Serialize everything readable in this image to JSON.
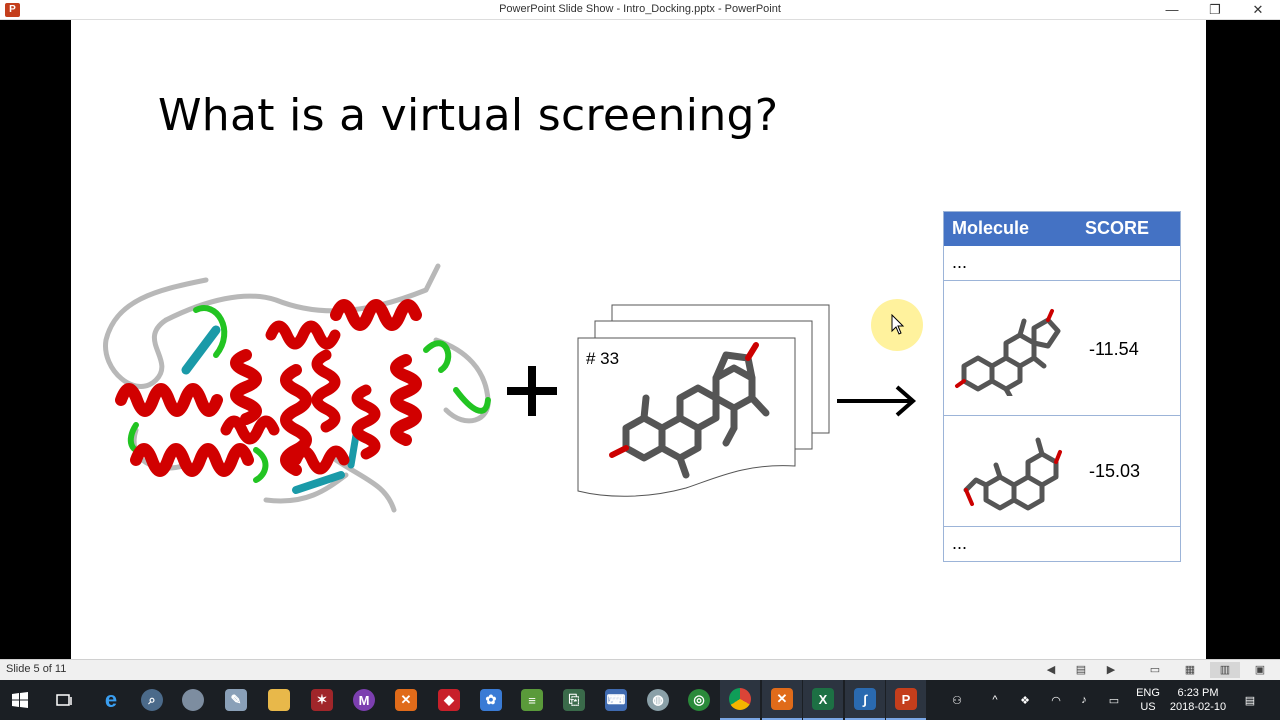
{
  "window": {
    "title": "PowerPoint Slide Show  -  Intro_Docking.pptx - PowerPoint",
    "app_icon_letter": "P",
    "minimize": "—",
    "restore": "❐",
    "close": "✕"
  },
  "slide": {
    "title": "What is a virtual screening?",
    "ligand_label": "# 33",
    "table": {
      "col_molecule": "Molecule",
      "col_score": "SCORE",
      "rows": [
        {
          "text": "..."
        },
        {
          "score": "-11.54"
        },
        {
          "score": "-15.03"
        },
        {
          "text": "..."
        }
      ]
    }
  },
  "statusbar": {
    "slide_count": "Slide 5 of 11"
  },
  "taskbar": {
    "language": "ENG",
    "region": "US",
    "time": "6:23 PM",
    "date": "2018-02-10"
  },
  "colors": {
    "header_blue": "#4472c4",
    "helix_red": "#d10000",
    "strand_cyan": "#1a9aa8",
    "loop_green": "#22c422"
  }
}
